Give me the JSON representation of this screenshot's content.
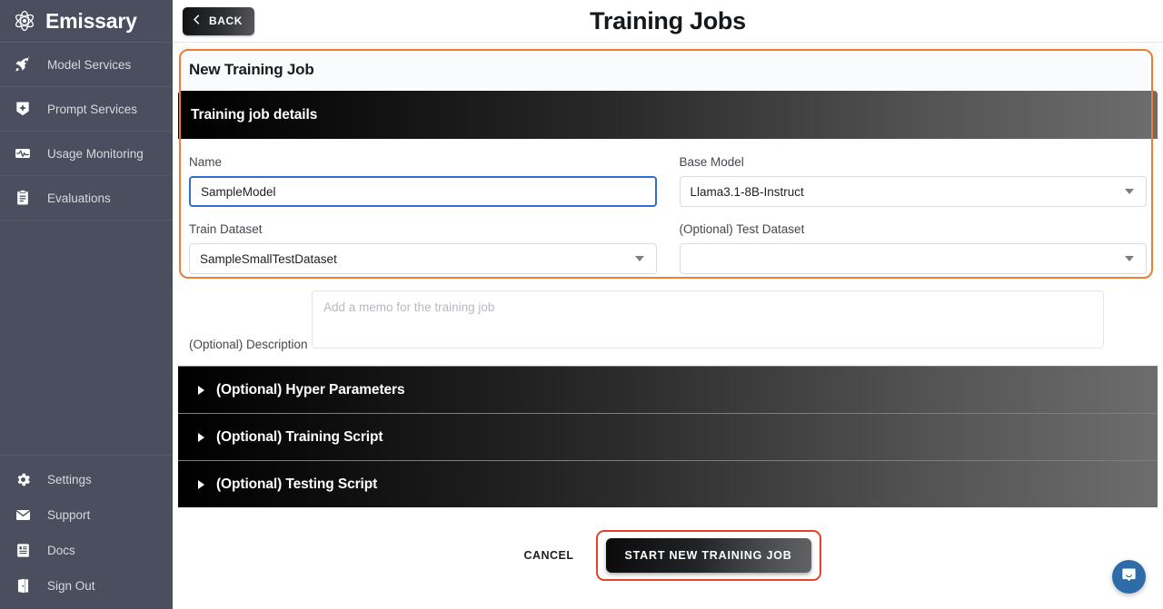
{
  "brand": {
    "name": "Emissary",
    "logo_icon": "emissary-atom-logo"
  },
  "sidebar": {
    "items": [
      {
        "label": "Model Services",
        "icon": "rocket-icon"
      },
      {
        "label": "Prompt Services",
        "icon": "prompt-badge-icon"
      },
      {
        "label": "Usage Monitoring",
        "icon": "activity-monitor-icon"
      },
      {
        "label": "Evaluations",
        "icon": "clipboard-icon"
      }
    ],
    "bottom_items": [
      {
        "label": "Settings",
        "icon": "gear-icon"
      },
      {
        "label": "Support",
        "icon": "envelope-icon"
      },
      {
        "label": "Docs",
        "icon": "document-icon"
      },
      {
        "label": "Sign Out",
        "icon": "sign-out-icon"
      }
    ]
  },
  "topbar": {
    "back_label": "BACK",
    "back_icon": "chevron-left-icon",
    "page_title": "Training Jobs"
  },
  "card": {
    "title": "New Training Job",
    "details_header": "Training job details",
    "highlight_color": "#ed7d31"
  },
  "form": {
    "name": {
      "label": "Name",
      "value": "SampleModel",
      "focused": true
    },
    "base_model": {
      "label": "Base Model",
      "value": "Llama3.1-8B-Instruct",
      "caret_icon": "chevron-down-icon"
    },
    "train_dataset": {
      "label": "Train Dataset",
      "value": "SampleSmallTestDataset",
      "caret_icon": "chevron-down-icon"
    },
    "test_dataset": {
      "label": "(Optional) Test Dataset",
      "value": "",
      "caret_icon": "chevron-down-icon"
    },
    "description": {
      "label": "(Optional) Description",
      "value": "",
      "placeholder": "Add a memo for the training job"
    }
  },
  "accordions": [
    {
      "label": "(Optional) Hyper Parameters",
      "arrow_icon": "triangle-right-icon",
      "expanded": false
    },
    {
      "label": "(Optional) Training Script",
      "arrow_icon": "triangle-right-icon",
      "expanded": false
    },
    {
      "label": "(Optional) Testing Script",
      "arrow_icon": "triangle-right-icon",
      "expanded": false
    }
  ],
  "actions": {
    "cancel_label": "CANCEL",
    "submit_label": "START NEW TRAINING JOB",
    "submit_highlight_color": "#e8402a"
  },
  "chat": {
    "icon": "chat-bubble-icon",
    "color": "#2d6ca7"
  }
}
